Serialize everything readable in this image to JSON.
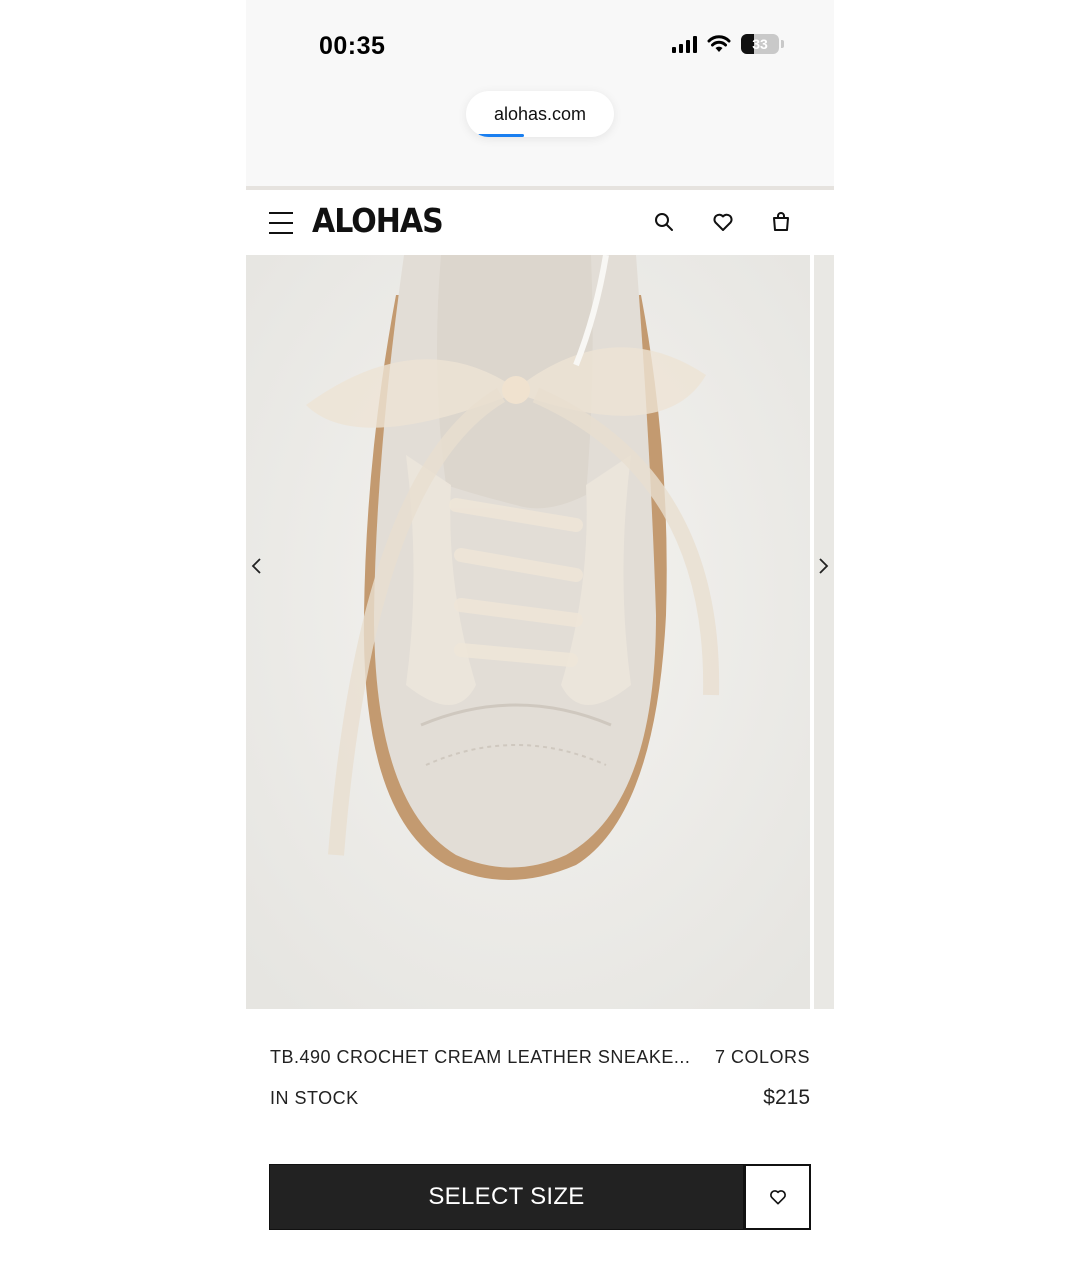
{
  "status_bar": {
    "time": "00:35",
    "battery": "33",
    "battery_level": 0.33
  },
  "browser": {
    "url": "alohas.com"
  },
  "header": {
    "logo": "ALOHAS",
    "icons": [
      "menu-icon",
      "search-icon",
      "heart-icon",
      "bag-icon"
    ]
  },
  "gallery": {
    "icons": [
      "chevron-left-icon",
      "chevron-right-icon"
    ]
  },
  "product": {
    "name": "TB.490 CROCHET CREAM LEATHER SNEAKE...",
    "colors": "7 COLORS",
    "stock": "IN STOCK",
    "price": "$215"
  },
  "actions": {
    "select_size_label": "SELECT SIZE",
    "wishlist_icon": "heart-icon"
  },
  "colors": {
    "button_dark": "#222222",
    "progress_blue": "#1a7ff0",
    "image_bg": "#efeeeb"
  }
}
